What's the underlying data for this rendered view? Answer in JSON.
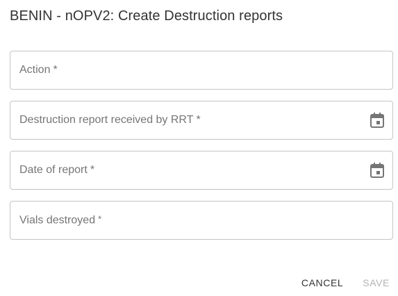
{
  "dialog": {
    "title": "BENIN - nOPV2: Create Destruction reports"
  },
  "fields": [
    {
      "label": "Action",
      "required_mark": "*",
      "icon": null
    },
    {
      "label": "Destruction report received by RRT",
      "required_mark": "*",
      "icon": "calendar-icon"
    },
    {
      "label": "Date of report",
      "required_mark": "*",
      "icon": "calendar-icon"
    },
    {
      "label": "Vials destroyed",
      "required_mark": "*",
      "icon": null
    }
  ],
  "actions": {
    "cancel_label": "CANCEL",
    "save_label": "SAVE",
    "save_disabled": true
  },
  "colors": {
    "border": "#c4c4c4",
    "label": "#757575",
    "title": "#333333",
    "disabled": "#b4b4b4",
    "icon": "#757575"
  }
}
